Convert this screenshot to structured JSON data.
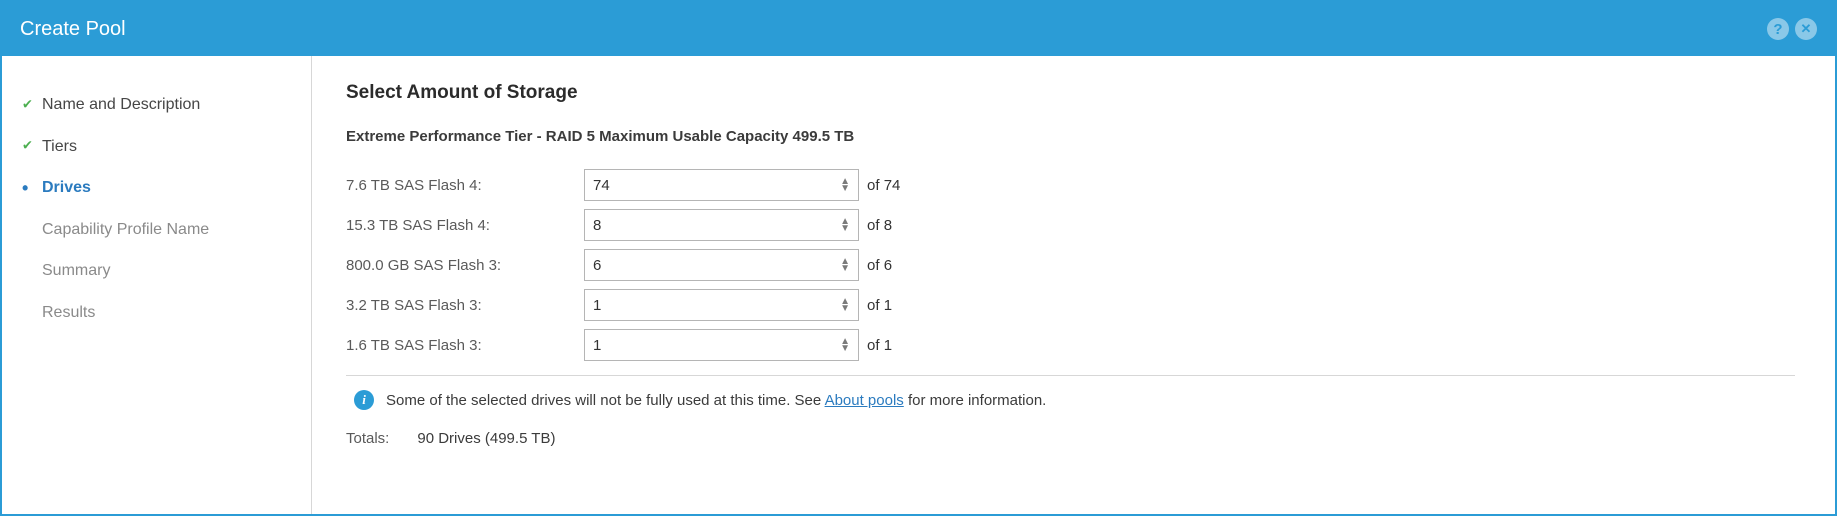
{
  "title": "Create Pool",
  "sidebar": {
    "items": [
      {
        "label": "Name and Description",
        "state": "done"
      },
      {
        "label": "Tiers",
        "state": "done"
      },
      {
        "label": "Drives",
        "state": "current"
      },
      {
        "label": "Capability Profile Name",
        "state": "pending"
      },
      {
        "label": "Summary",
        "state": "pending"
      },
      {
        "label": "Results",
        "state": "pending"
      }
    ]
  },
  "main": {
    "heading": "Select Amount of Storage",
    "tier_label": "Extreme Performance Tier - RAID 5 Maximum Usable Capacity 499.5 TB",
    "drives": [
      {
        "label": "7.6 TB SAS Flash 4:",
        "value": "74",
        "max": "74"
      },
      {
        "label": "15.3 TB SAS Flash 4:",
        "value": "8",
        "max": "8"
      },
      {
        "label": "800.0 GB SAS Flash 3:",
        "value": "6",
        "max": "6"
      },
      {
        "label": "3.2 TB SAS Flash 3:",
        "value": "1",
        "max": "1"
      },
      {
        "label": "1.6 TB SAS Flash 3:",
        "value": "1",
        "max": "1"
      }
    ],
    "info_prefix": "Some of the selected drives will not be fully used at this time. See ",
    "info_link": "About pools",
    "info_suffix": " for more information.",
    "totals_label": "Totals:",
    "totals_value": "90 Drives (499.5 TB)",
    "of_word": "of"
  }
}
